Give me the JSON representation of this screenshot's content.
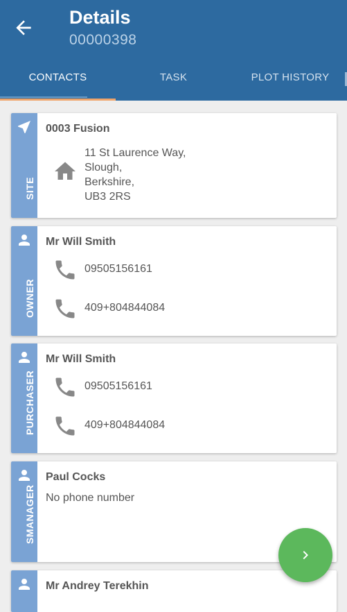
{
  "header": {
    "title": "Details",
    "subtitle": "00000398",
    "tabs": [
      {
        "label": "CONTACTS",
        "active": true
      },
      {
        "label": "TASK",
        "active": false
      },
      {
        "label": "PLOT HISTORY",
        "active": false
      }
    ]
  },
  "colors": {
    "header_bg": "#2d6aa0",
    "strip_bg": "#7aa3d4",
    "tab_indicator": "#f0a46a",
    "fab_bg": "#5cb85c"
  },
  "cards": {
    "site": {
      "label": "SITE",
      "icon": "navigation-arrow-icon",
      "name": "0003 Fusion",
      "address": [
        "11 St Laurence Way,",
        "Slough,",
        "Berkshire,",
        "UB3 2RS"
      ]
    },
    "owner": {
      "label": "OWNER",
      "icon": "person-icon",
      "name": "Mr Will Smith",
      "phones": [
        "09505156161",
        "409+804844084"
      ]
    },
    "purchaser": {
      "label": "PURCHASER",
      "icon": "person-icon",
      "name": "Mr Will Smith",
      "phones": [
        "09505156161",
        "409+804844084"
      ]
    },
    "smanager": {
      "label": "SMANAGER",
      "icon": "person-icon",
      "name": "Paul Cocks",
      "no_phone": "No phone number"
    },
    "fifth": {
      "icon": "person-icon",
      "name": "Mr Andrey Terekhin"
    }
  },
  "fab": {
    "icon": "chevron-right-icon"
  }
}
